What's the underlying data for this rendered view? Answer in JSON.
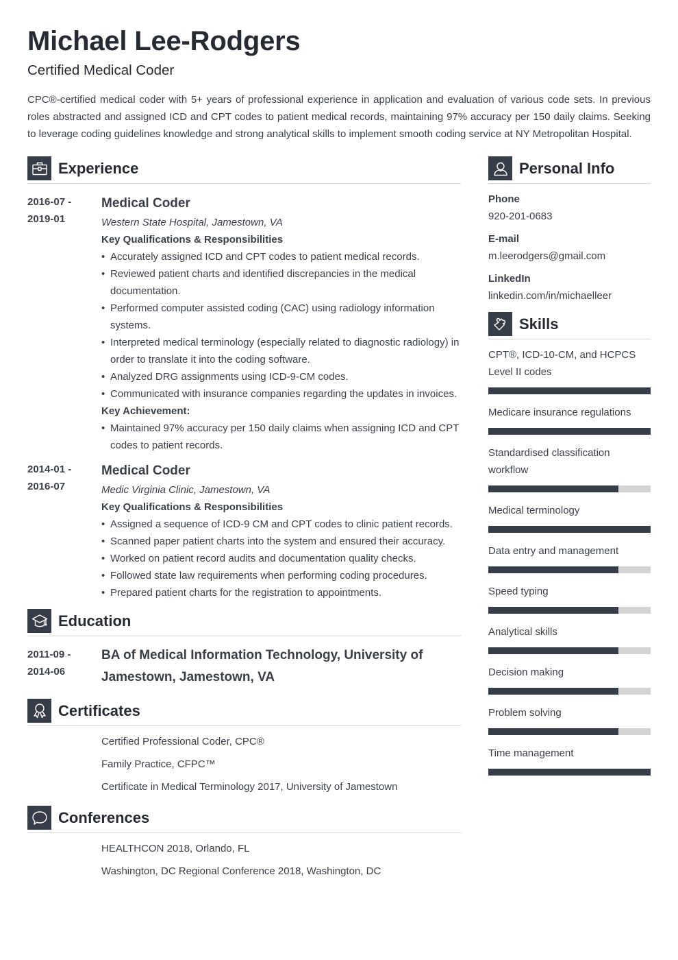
{
  "header": {
    "name": "Michael Lee-Rodgers",
    "title": "Certified Medical Coder",
    "summary": "CPC®-certified medical coder with 5+ years of professional experience in application and evaluation of various code sets. In previous roles abstracted and assigned ICD and CPT codes to patient medical records, maintaining 97% accuracy per 150 daily claims. Seeking to leverage coding guidelines knowledge and strong analytical skills to implement smooth coding service at NY Metropolitan Hospital."
  },
  "experience": {
    "heading": "Experience",
    "icon": "briefcase-icon",
    "jobs": [
      {
        "date_start": "2016-07 -",
        "date_end": "2019-01",
        "title": "Medical Coder",
        "company": "Western State Hospital, Jamestown, VA",
        "qual_heading": "Key Qualifications & Responsibilities",
        "bullets": [
          "Accurately assigned ICD and CPT codes to patient medical records.",
          "Reviewed patient charts and identified discrepancies in the medical documentation.",
          "Performed computer assisted coding (CAC) using radiology information systems.",
          "Interpreted medical terminology (especially related to diagnostic radiology) in order to translate it into the coding software.",
          "Analyzed DRG assignments using ICD-9-CM codes.",
          "Communicated with insurance companies regarding the updates in invoices."
        ],
        "achievement_heading": "Key Achievement:",
        "achievements": [
          "Maintained 97% accuracy per 150 daily claims when assigning ICD and CPT codes to patient records."
        ]
      },
      {
        "date_start": "2014-01 -",
        "date_end": "2016-07",
        "title": "Medical Coder",
        "company": "Medic Virginia Clinic, Jamestown, VA",
        "qual_heading": "Key Qualifications & Responsibilities",
        "bullets": [
          "Assigned a sequence of ICD-9 CM and CPT codes to clinic patient records.",
          "Scanned paper patient charts into the system and ensured their accuracy.",
          "Worked on patient record audits and documentation quality checks.",
          "Followed state law requirements when performing coding procedures.",
          "Prepared patient charts for the registration to appointments."
        ]
      }
    ]
  },
  "education": {
    "heading": "Education",
    "icon": "graduation-cap-icon",
    "items": [
      {
        "date_start": "2011-09 -",
        "date_end": "2014-06",
        "title": "BA of Medical Information Technology,  University of Jamestown, Jamestown, VA"
      }
    ]
  },
  "certificates": {
    "heading": "Certificates",
    "icon": "award-ribbon-icon",
    "items": [
      "Certified Professional Coder, CPC®",
      "Family Practice, CFPC™",
      "Certificate in Medical Terminology 2017, University of Jamestown"
    ]
  },
  "conferences": {
    "heading": "Conferences",
    "icon": "speech-bubble-icon",
    "items": [
      "HEALTHCON 2018, Orlando, FL",
      "Washington, DC Regional Conference 2018, Washington, DC"
    ]
  },
  "personal_info": {
    "heading": "Personal Info",
    "icon": "person-icon",
    "fields": [
      {
        "label": "Phone",
        "value": "920-201-0683"
      },
      {
        "label": "E-mail",
        "value": "m.leerodgers@gmail.com"
      },
      {
        "label": "LinkedIn",
        "value": "linkedin.com/in/michaelleer"
      }
    ]
  },
  "skills": {
    "heading": "Skills",
    "icon": "puzzle-piece-icon",
    "items": [
      {
        "name": "CPT®, ICD-10-CM, and HCPCS Level II codes",
        "level": 1.0
      },
      {
        "name": "Medicare insurance regulations",
        "level": 1.0
      },
      {
        "name": "Standardised classification workflow",
        "level": 0.8
      },
      {
        "name": "Medical terminology",
        "level": 1.0
      },
      {
        "name": "Data entry and management",
        "level": 0.8
      },
      {
        "name": "Speed typing",
        "level": 0.8
      },
      {
        "name": "Analytical skills",
        "level": 0.8
      },
      {
        "name": "Decision making",
        "level": 0.8
      },
      {
        "name": "Problem solving",
        "level": 0.8
      },
      {
        "name": "Time management",
        "level": 1.0
      }
    ]
  },
  "colors": {
    "accent": "#363c48",
    "bar_track": "#d4d4d4",
    "text": "#3a3f47",
    "heading": "#262b33"
  }
}
